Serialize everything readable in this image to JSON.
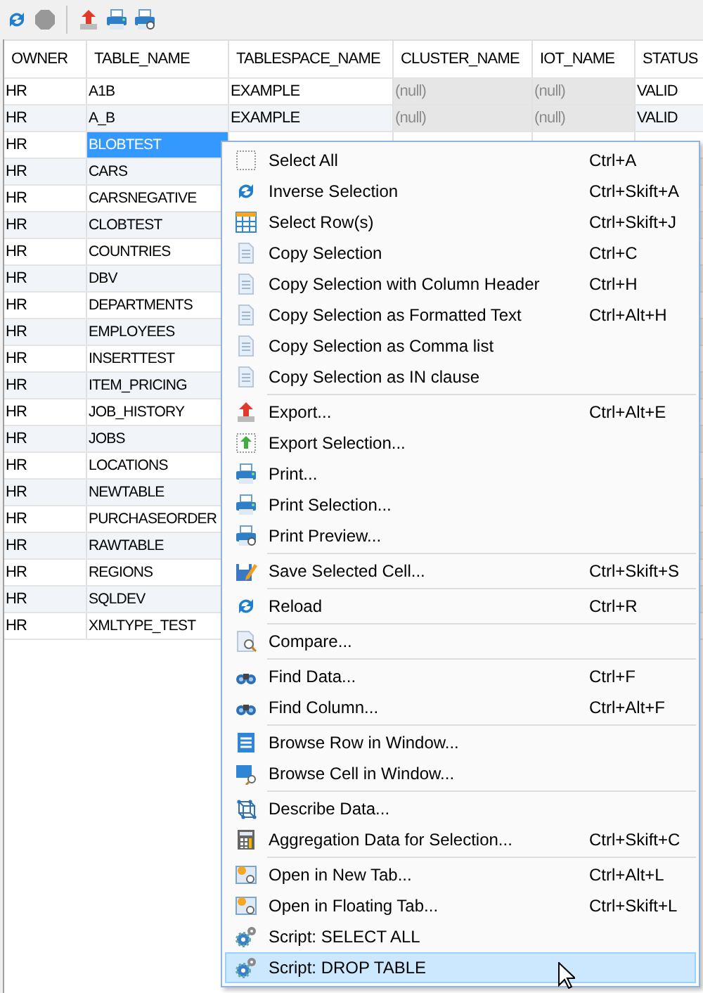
{
  "toolbar": {
    "groups": [
      [
        {
          "disabled": false
        },
        {
          "disabled": true
        }
      ],
      [
        {
          "disabled": false
        },
        {
          "disabled": false
        },
        {
          "disabled": false
        }
      ]
    ]
  },
  "table": {
    "columns": [
      "OWNER",
      "TABLE_NAME",
      "TABLESPACE_NAME",
      "CLUSTER_NAME",
      "IOT_NAME",
      "STATUS"
    ],
    "rows": [
      {
        "selected": false,
        "cells": [
          {
            "text": "HR",
            "null": false
          },
          {
            "text": "A1B",
            "null": false
          },
          {
            "text": "EXAMPLE",
            "null": false
          },
          {
            "text": "(null)",
            "null": true
          },
          {
            "text": "(null)",
            "null": true
          },
          {
            "text": "VALID",
            "null": false
          }
        ]
      },
      {
        "selected": false,
        "cells": [
          {
            "text": "HR",
            "null": false
          },
          {
            "text": "A_B",
            "null": false
          },
          {
            "text": "EXAMPLE",
            "null": false
          },
          {
            "text": "(null)",
            "null": true
          },
          {
            "text": "(null)",
            "null": true
          },
          {
            "text": "VALID",
            "null": false
          }
        ]
      },
      {
        "selected": true,
        "cells": [
          {
            "text": "HR",
            "null": false
          },
          {
            "text": "BLOBTEST",
            "null": false
          }
        ]
      },
      {
        "selected": false,
        "cells": [
          {
            "text": "HR",
            "null": false
          },
          {
            "text": "CARS",
            "null": false
          }
        ]
      },
      {
        "selected": false,
        "cells": [
          {
            "text": "HR",
            "null": false
          },
          {
            "text": "CARSNEGATIVE",
            "null": false
          }
        ]
      },
      {
        "selected": false,
        "cells": [
          {
            "text": "HR",
            "null": false
          },
          {
            "text": "CLOBTEST",
            "null": false
          }
        ]
      },
      {
        "selected": false,
        "cells": [
          {
            "text": "HR",
            "null": false
          },
          {
            "text": "COUNTRIES",
            "null": false
          }
        ]
      },
      {
        "selected": false,
        "cells": [
          {
            "text": "HR",
            "null": false
          },
          {
            "text": "DBV",
            "null": false
          }
        ]
      },
      {
        "selected": false,
        "cells": [
          {
            "text": "HR",
            "null": false
          },
          {
            "text": "DEPARTMENTS",
            "null": false
          }
        ]
      },
      {
        "selected": false,
        "cells": [
          {
            "text": "HR",
            "null": false
          },
          {
            "text": "EMPLOYEES",
            "null": false
          }
        ]
      },
      {
        "selected": false,
        "cells": [
          {
            "text": "HR",
            "null": false
          },
          {
            "text": "INSERTTEST",
            "null": false
          }
        ]
      },
      {
        "selected": false,
        "cells": [
          {
            "text": "HR",
            "null": false
          },
          {
            "text": "ITEM_PRICING",
            "null": false
          }
        ]
      },
      {
        "selected": false,
        "cells": [
          {
            "text": "HR",
            "null": false
          },
          {
            "text": "JOB_HISTORY",
            "null": false
          }
        ]
      },
      {
        "selected": false,
        "cells": [
          {
            "text": "HR",
            "null": false
          },
          {
            "text": "JOBS",
            "null": false
          }
        ]
      },
      {
        "selected": false,
        "cells": [
          {
            "text": "HR",
            "null": false
          },
          {
            "text": "LOCATIONS",
            "null": false
          }
        ]
      },
      {
        "selected": false,
        "cells": [
          {
            "text": "HR",
            "null": false
          },
          {
            "text": "NEWTABLE",
            "null": false
          }
        ]
      },
      {
        "selected": false,
        "cells": [
          {
            "text": "HR",
            "null": false
          },
          {
            "text": "PURCHASEORDER",
            "null": false
          }
        ]
      },
      {
        "selected": false,
        "cells": [
          {
            "text": "HR",
            "null": false
          },
          {
            "text": "RAWTABLE",
            "null": false
          }
        ]
      },
      {
        "selected": false,
        "cells": [
          {
            "text": "HR",
            "null": false
          },
          {
            "text": "REGIONS",
            "null": false
          }
        ]
      },
      {
        "selected": false,
        "cells": [
          {
            "text": "HR",
            "null": false
          },
          {
            "text": "SQLDEV",
            "null": false
          }
        ]
      },
      {
        "selected": false,
        "cells": [
          {
            "text": "HR",
            "null": false
          },
          {
            "text": "XMLTYPE_TEST",
            "null": false
          }
        ]
      }
    ]
  },
  "context_menu": {
    "groups": [
      [
        {
          "label": "Select All",
          "shortcut": "Ctrl+A",
          "selected": false
        },
        {
          "label": "Inverse Selection",
          "shortcut": "Ctrl+Skift+A",
          "selected": false
        },
        {
          "label": "Select Row(s)",
          "shortcut": "Ctrl+Skift+J",
          "selected": false
        },
        {
          "label": "Copy Selection",
          "shortcut": "Ctrl+C",
          "selected": false
        },
        {
          "label": "Copy Selection with Column Header",
          "shortcut": "Ctrl+H",
          "selected": false
        },
        {
          "label": "Copy Selection as Formatted Text",
          "shortcut": "Ctrl+Alt+H",
          "selected": false
        },
        {
          "label": "Copy Selection as Comma list",
          "selected": false
        },
        {
          "label": "Copy Selection as IN clause",
          "selected": false
        }
      ],
      [
        {
          "label": "Export...",
          "shortcut": "Ctrl+Alt+E",
          "selected": false
        },
        {
          "label": "Export Selection...",
          "selected": false
        },
        {
          "label": "Print...",
          "selected": false
        },
        {
          "label": "Print Selection...",
          "selected": false
        },
        {
          "label": "Print Preview...",
          "selected": false
        }
      ],
      [
        {
          "label": "Save Selected Cell...",
          "shortcut": "Ctrl+Skift+S",
          "selected": false
        }
      ],
      [
        {
          "label": "Reload",
          "shortcut": "Ctrl+R",
          "selected": false
        }
      ],
      [
        {
          "label": "Compare...",
          "selected": false
        }
      ],
      [
        {
          "label": "Find Data...",
          "shortcut": "Ctrl+F",
          "selected": false
        },
        {
          "label": "Find Column...",
          "shortcut": "Ctrl+Alt+F",
          "selected": false
        }
      ],
      [
        {
          "label": "Browse Row in Window...",
          "selected": false
        },
        {
          "label": "Browse Cell in Window...",
          "selected": false
        }
      ],
      [
        {
          "label": "Describe Data...",
          "selected": false
        },
        {
          "label": "Aggregation Data for Selection...",
          "shortcut": "Ctrl+Skift+C",
          "selected": false
        }
      ],
      [
        {
          "label": "Open in New Tab...",
          "shortcut": "Ctrl+Alt+L",
          "selected": false
        },
        {
          "label": "Open in Floating Tab...",
          "shortcut": "Ctrl+Skift+L",
          "selected": false
        },
        {
          "label": "Script: SELECT ALL",
          "selected": false
        },
        {
          "label": "Script: DROP TABLE",
          "selected": true
        }
      ]
    ]
  }
}
